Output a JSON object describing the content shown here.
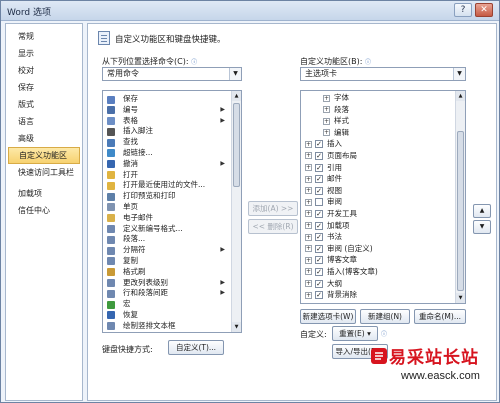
{
  "window": {
    "title": "Word 选项",
    "controls": [
      "?",
      "✕"
    ]
  },
  "nav": {
    "items": [
      {
        "label": "常规"
      },
      {
        "label": "显示"
      },
      {
        "label": "校对"
      },
      {
        "label": "保存"
      },
      {
        "label": "版式"
      },
      {
        "label": "语言"
      },
      {
        "label": "高级"
      },
      {
        "label": "自定义功能区",
        "selected": true
      },
      {
        "label": "快速访问工具栏"
      },
      {
        "label": "加载项"
      },
      {
        "label": "信任中心"
      }
    ]
  },
  "header": {
    "text": "自定义功能区和键盘快捷键。"
  },
  "left_panel": {
    "label": "从下列位置选择命令(C):",
    "info": "ⓘ",
    "dropdown_value": "常用命令",
    "commands": [
      {
        "label": "保存",
        "icon": "save-icon",
        "color": "#5a7fc0"
      },
      {
        "label": "编号",
        "icon": "numbering-icon",
        "color": "#4a6fa8",
        "submenu": true
      },
      {
        "label": "表格",
        "icon": "table-icon",
        "color": "#6d8fc6",
        "submenu": true
      },
      {
        "label": "插入脚注",
        "icon": "footnote-icon",
        "color": "#555555"
      },
      {
        "label": "查找",
        "icon": "find-icon",
        "color": "#4b7bb8"
      },
      {
        "label": "超链接...",
        "icon": "hyperlink-icon",
        "color": "#3f8ac9"
      },
      {
        "label": "撤消",
        "icon": "undo-icon",
        "color": "#3566b0",
        "submenu": true
      },
      {
        "label": "打开",
        "icon": "open-folder-icon",
        "color": "#e0b440"
      },
      {
        "label": "打开最近使用过的文件...",
        "icon": "recent-file-icon",
        "color": "#e0b440"
      },
      {
        "label": "打印预览和打印",
        "icon": "print-preview-icon",
        "color": "#5d7fa8"
      },
      {
        "label": "单页",
        "icon": "single-page-icon",
        "color": "#7f93b1"
      },
      {
        "label": "电子邮件",
        "icon": "email-icon",
        "color": "#d9b14a"
      },
      {
        "label": "定义新编号格式...",
        "icon": "new-numbering-icon",
        "color": "#6f88b0"
      },
      {
        "label": "段落...",
        "icon": "paragraph-icon",
        "color": "#6f88b0"
      },
      {
        "label": "分隔符",
        "icon": "separator-icon",
        "color": "#6f88b0",
        "submenu": true
      },
      {
        "label": "复制",
        "icon": "copy-icon",
        "color": "#6f88b0"
      },
      {
        "label": "格式刷",
        "icon": "format-painter-icon",
        "color": "#c99a36"
      },
      {
        "label": "更改列表级别",
        "icon": "list-level-icon",
        "color": "#6f88b0",
        "submenu": true
      },
      {
        "label": "行和段落间距",
        "icon": "line-spacing-icon",
        "color": "#6f88b0",
        "submenu": true
      },
      {
        "label": "宏",
        "icon": "macro-icon",
        "color": "#3f9a3f"
      },
      {
        "label": "恢复",
        "icon": "redo-icon",
        "color": "#3566b0"
      },
      {
        "label": "绘制竖排文本框",
        "icon": "vertical-textbox-icon",
        "color": "#6f88b0"
      },
      {
        "label": "绘制表格",
        "icon": "draw-table-icon",
        "color": "#6f88b0"
      }
    ]
  },
  "middle": {
    "add_label": "添加(A) >>",
    "remove_label": "<< 删除(R)"
  },
  "right_panel": {
    "label": "自定义功能区(B):",
    "info": "ⓘ",
    "dropdown_value": "主选项卡",
    "tree": [
      {
        "label": "字体",
        "level": 2,
        "expander": "+"
      },
      {
        "label": "段落",
        "level": 2,
        "expander": "+"
      },
      {
        "label": "样式",
        "level": 2,
        "expander": "+"
      },
      {
        "label": "编辑",
        "level": 2,
        "expander": "+"
      },
      {
        "label": "插入",
        "level": 1,
        "expander": "+",
        "checked": true
      },
      {
        "label": "页面布局",
        "level": 1,
        "expander": "+",
        "checked": true
      },
      {
        "label": "引用",
        "level": 1,
        "expander": "+",
        "checked": true
      },
      {
        "label": "邮件",
        "level": 1,
        "expander": "+",
        "checked": true
      },
      {
        "label": "视图",
        "level": 1,
        "expander": "+",
        "checked": true
      },
      {
        "label": "审阅",
        "level": 1,
        "expander": "+",
        "checked": false
      },
      {
        "label": "开发工具",
        "level": 1,
        "expander": "+",
        "checked": true
      },
      {
        "label": "加载项",
        "level": 1,
        "expander": "+",
        "checked": true
      },
      {
        "label": "书法",
        "level": 1,
        "expander": "+",
        "checked": true
      },
      {
        "label": "审阅 (自定义)",
        "level": 1,
        "expander": "+",
        "checked": true
      },
      {
        "label": "博客文章",
        "level": 1,
        "expander": "+",
        "checked": true
      },
      {
        "label": "插入(博客文章)",
        "level": 1,
        "expander": "+",
        "checked": true
      },
      {
        "label": "大纲",
        "level": 1,
        "expander": "+",
        "checked": true
      },
      {
        "label": "背景消除",
        "level": 1,
        "expander": "+",
        "checked": true
      }
    ],
    "new_tab_label": "新建选项卡(W)",
    "new_group_label": "新建组(N)",
    "rename_label": "重命名(M)...",
    "customize_label": "自定义:",
    "reset_label": "重置(E) ▾",
    "import_export_label": "导入/导出(P) ▾",
    "up_arrow": "▲",
    "down_arrow": "▼"
  },
  "keyboard": {
    "label": "键盘快捷方式:",
    "button_label": "自定义(T)..."
  },
  "watermark": {
    "text": "易采站长站",
    "url": "www.easck.com"
  }
}
